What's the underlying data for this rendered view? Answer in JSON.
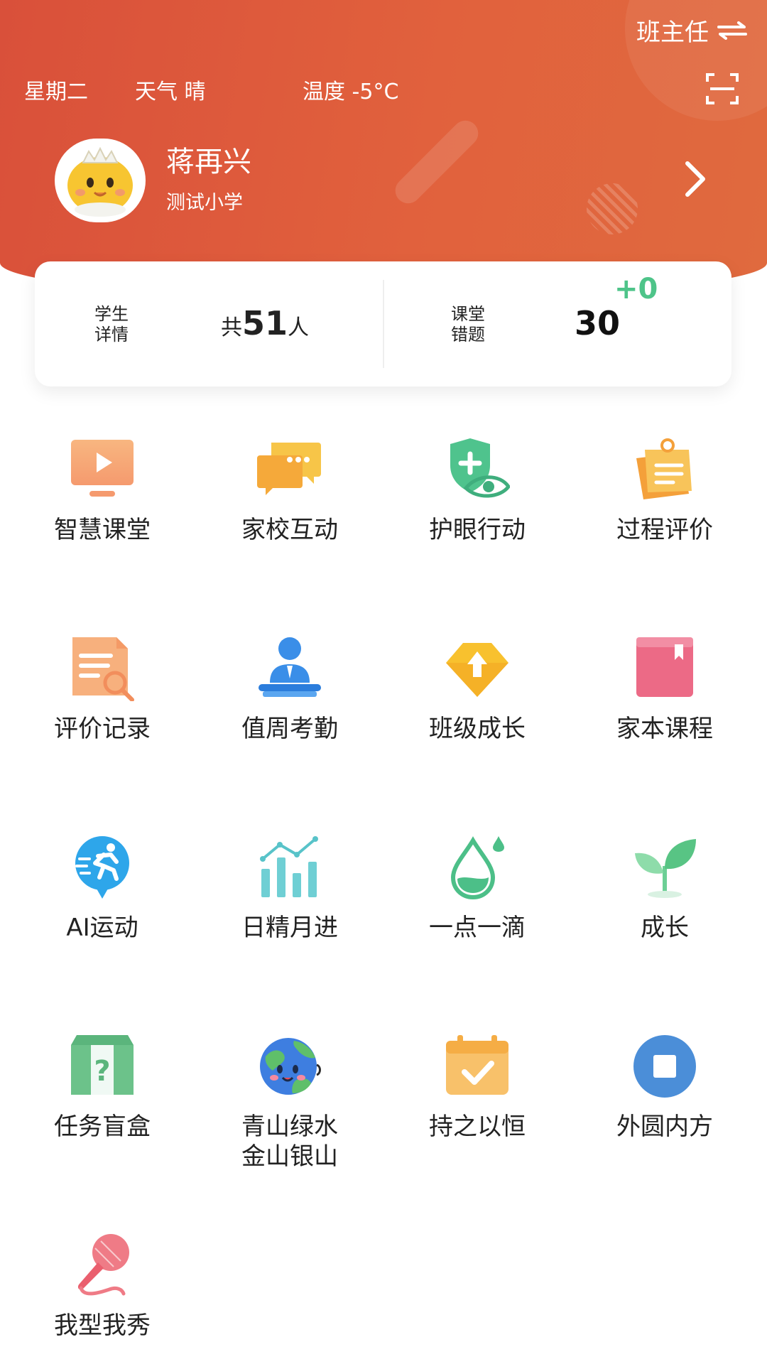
{
  "header": {
    "role_label": "班主任",
    "weekday": "星期二",
    "weather": "天气 晴",
    "temperature": "温度 -5°C"
  },
  "profile": {
    "name": "蒋再兴",
    "school": "测试小学"
  },
  "stats": {
    "students_label_line1": "学生",
    "students_label_line2": "详情",
    "students_prefix": "共",
    "students_count": "51",
    "students_suffix": "人",
    "wrong_label_line1": "课堂",
    "wrong_label_line2": "错题",
    "wrong_count": "30",
    "wrong_delta": "+0"
  },
  "colors": {
    "header_red": "#d9503a",
    "accent_green": "#4ec489"
  },
  "grid": [
    {
      "label": "智慧课堂",
      "icon": "video-screen-icon"
    },
    {
      "label": "家校互动",
      "icon": "chat-bubbles-icon"
    },
    {
      "label": "护眼行动",
      "icon": "eye-shield-icon"
    },
    {
      "label": "过程评价",
      "icon": "clipboard-icon"
    },
    {
      "label": "评价记录",
      "icon": "record-search-icon"
    },
    {
      "label": "值周考勤",
      "icon": "podium-person-icon"
    },
    {
      "label": "班级成长",
      "icon": "diamond-arrow-icon"
    },
    {
      "label": "家本课程",
      "icon": "book-icon"
    },
    {
      "label": "AI运动",
      "icon": "running-man-icon"
    },
    {
      "label": "日精月进",
      "icon": "bar-chart-icon"
    },
    {
      "label": "一点一滴",
      "icon": "water-drop-icon"
    },
    {
      "label": "成长",
      "icon": "sprout-icon"
    },
    {
      "label": "任务盲盒",
      "icon": "mystery-box-icon"
    },
    {
      "label": "青山绿水\n金山银山",
      "icon": "earth-icon"
    },
    {
      "label": "持之以恒",
      "icon": "calendar-check-icon"
    },
    {
      "label": "外圆内方",
      "icon": "circle-square-icon"
    },
    {
      "label": "我型我秀",
      "icon": "microphone-icon"
    }
  ]
}
